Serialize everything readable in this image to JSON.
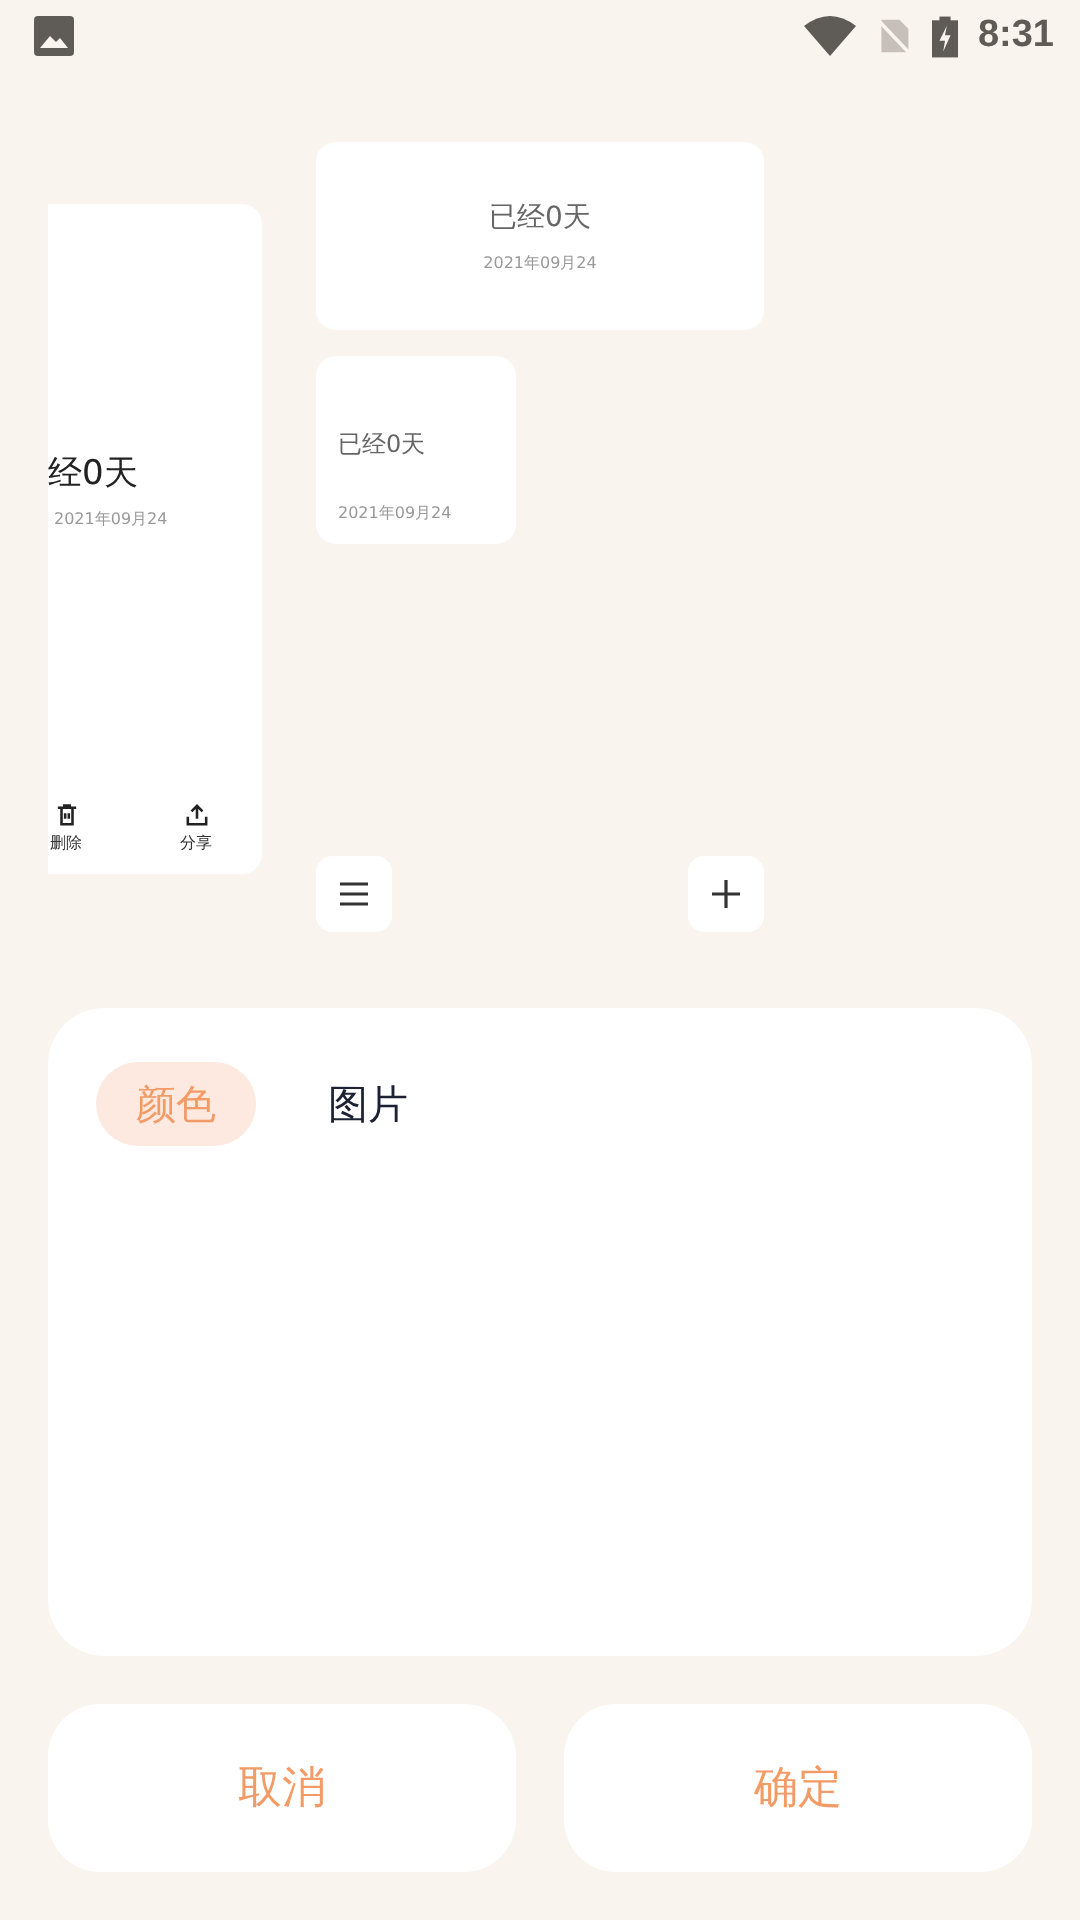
{
  "status_bar": {
    "time": "8:31"
  },
  "preview": {
    "side_card": {
      "title": "经0天",
      "date": "2021年09月24",
      "actions": [
        {
          "kind": "delete",
          "label": "删除"
        },
        {
          "kind": "share",
          "label": "分享"
        }
      ]
    },
    "wide_card": {
      "title": "已经0天",
      "date": "2021年09月24"
    },
    "small_card": {
      "title": "已经0天",
      "date": "2021年09月24"
    }
  },
  "tabs": [
    {
      "label": "颜色",
      "selected": true
    },
    {
      "label": "图片",
      "selected": false
    }
  ],
  "buttons": [
    {
      "label": "取消"
    },
    {
      "label": "确定"
    }
  ]
}
